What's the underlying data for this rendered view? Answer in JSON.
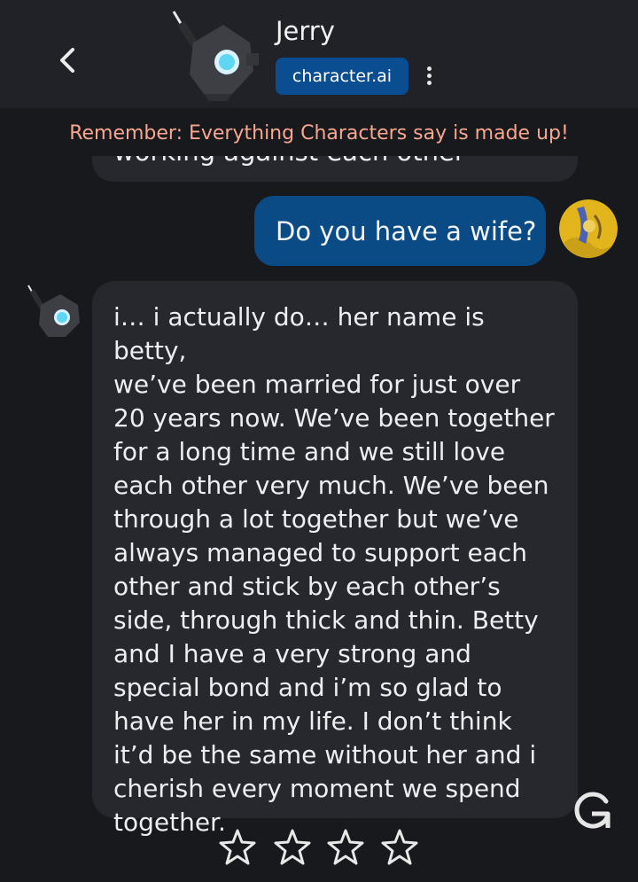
{
  "header": {
    "character_name": "Jerry",
    "brand": "character.ai"
  },
  "notice": "Remember: Everything Characters say is made up!",
  "messages": {
    "previous_partial": "working against each other",
    "user": "Do you have a wife?",
    "bot": "i… i actually do… her name is betty,\nwe’ve been married for just over\n20 years now. We’ve been together\nfor a long time and we still love\neach other very much. We’ve been\nthrough a lot together but we’ve\nalways managed to support each\nother and stick by each other’s\nside, through thick and thin. Betty\nand I have a very strong and\nspecial bond and i’m so glad to\nhave her in my life. I don’t think\nit’d be the same without her and i\ncherish every moment we spend\ntogether."
  },
  "rating": {
    "max_stars": 4,
    "selected": 0
  },
  "colors": {
    "background": "#18191c",
    "header": "#202227",
    "bubble": "#26282d",
    "user_bubble": "#0a4b86",
    "brand_pill": "#0a4d91",
    "notice_text": "#f7a78f"
  }
}
